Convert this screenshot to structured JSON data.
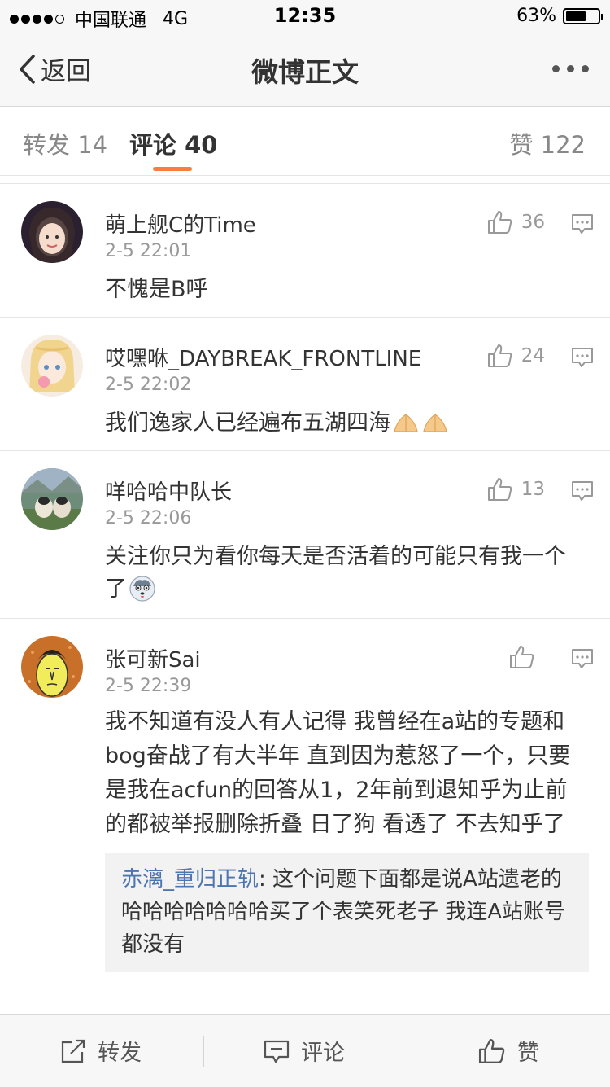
{
  "status_bar": {
    "carrier": "中国联通",
    "network": "4G",
    "time": "12:35",
    "battery_text": "63%",
    "battery_level": 0.63
  },
  "navbar": {
    "back_label": "返回",
    "title": "微博正文",
    "more_icon": "more-dots-icon"
  },
  "tabs": {
    "repost": "转发 14",
    "comment": "评论 40",
    "like": "赞 122",
    "active_color": "#fa7d3c"
  },
  "comments": [
    {
      "name": "萌上舰C的Time",
      "time": "2-5 22:01",
      "likes": "36",
      "text": "不愧是B呼"
    },
    {
      "name": "哎嘿咻_DAYBREAK_FRONTLINE",
      "time": "2-5 22:02",
      "likes": "24",
      "text": "我们逸家人已经遍布五湖四海"
    },
    {
      "name": "咩哈哈中队长",
      "time": "2-5 22:06",
      "likes": "13",
      "text": "关注你只为看你每天是否活着的可能只有我一个了"
    },
    {
      "name": "张可新Sai",
      "time": "2-5 22:39",
      "likes": "",
      "text": "我不知道有没人有人记得 我曾经在a站的专题和bog奋战了有大半年 直到因为惹怒了一个，只要是我在acfun的回答从1，2年前到退知乎为止前的都被举报删除折叠 日了狗 看透了 不去知乎了",
      "quote_name": "赤漓_重归正轨",
      "quote_text": ": 这个问题下面都是说A站遗老的 哈哈哈哈哈哈哈买了个表笑死老子 我连A站账号都没有"
    }
  ],
  "bottom_bar": {
    "repost": "转发",
    "comment": "评论",
    "like": "赞"
  }
}
